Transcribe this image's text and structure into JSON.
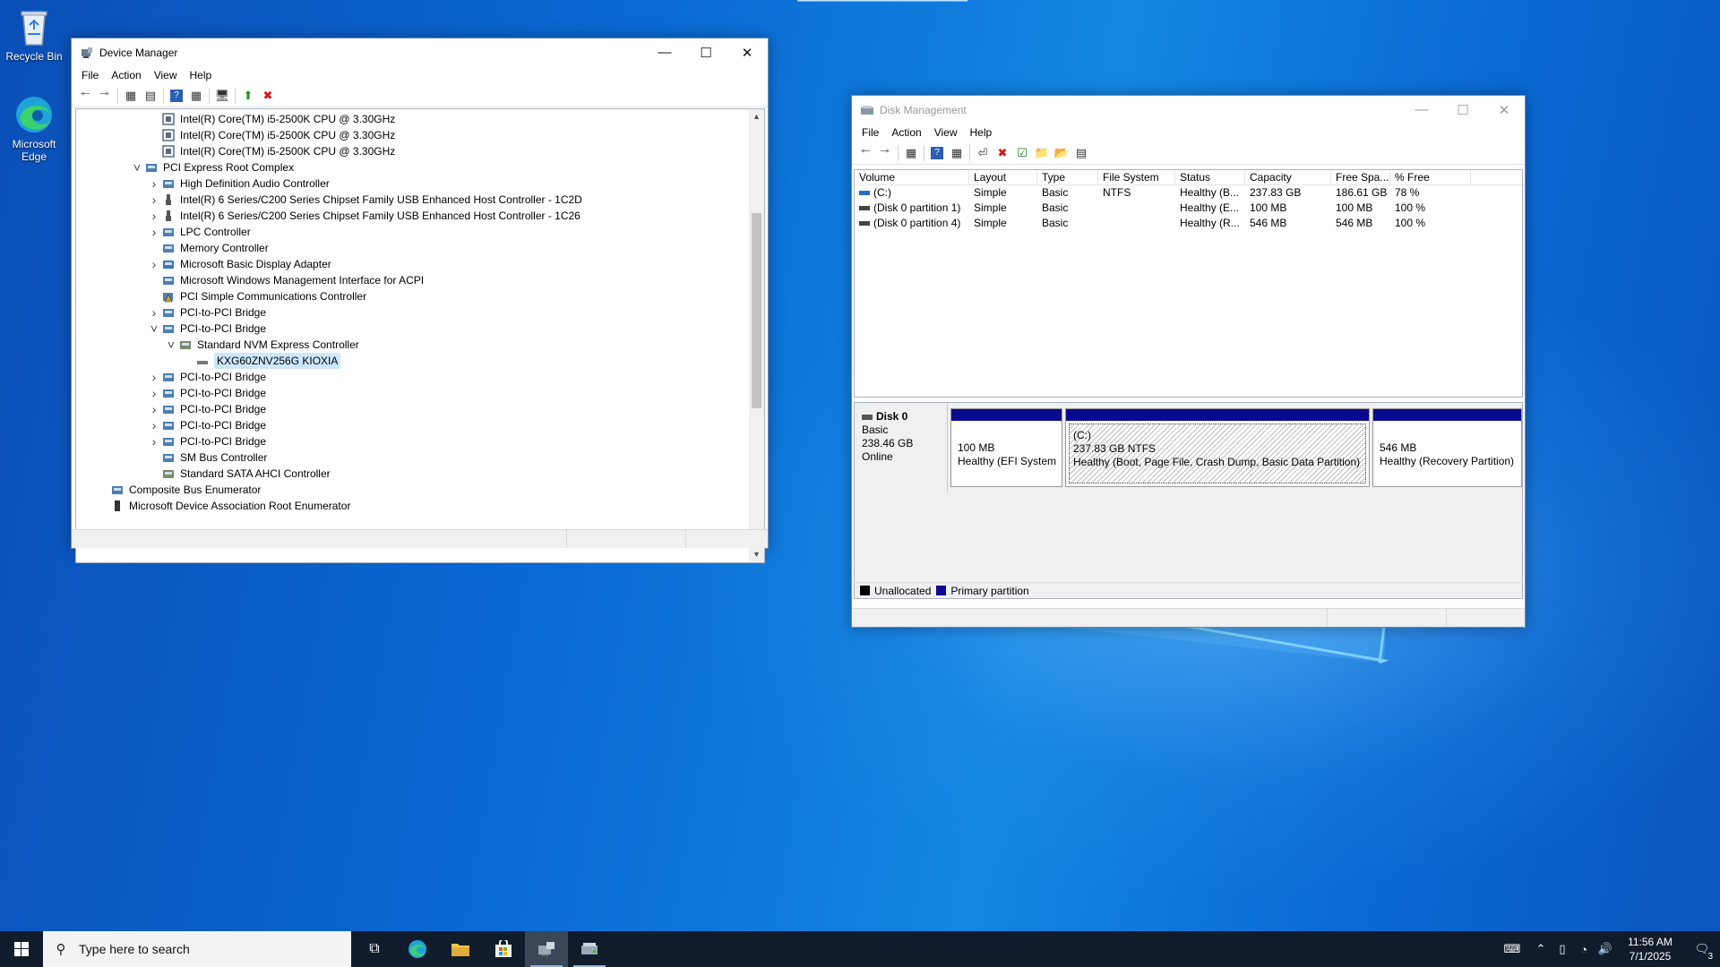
{
  "desktop": {
    "icons": [
      {
        "label": "Recycle Bin",
        "icon": "recycle-bin-icon"
      },
      {
        "label": "Microsoft Edge",
        "icon": "edge-icon"
      }
    ]
  },
  "device_manager": {
    "title": "Device Manager",
    "menu": [
      "File",
      "Action",
      "View",
      "Help"
    ],
    "tree": [
      {
        "label": "Intel(R) Core(TM) i5-2500K CPU @ 3.30GHz",
        "expander": "",
        "icon": "cpu-icon"
      },
      {
        "label": "Intel(R) Core(TM) i5-2500K CPU @ 3.30GHz",
        "expander": "",
        "icon": "cpu-icon"
      },
      {
        "label": "Intel(R) Core(TM) i5-2500K CPU @ 3.30GHz",
        "expander": "",
        "icon": "cpu-icon"
      },
      {
        "label": "PCI Express Root Complex",
        "expander": "expanded",
        "icon": "system-device-icon"
      },
      {
        "label": "High Definition Audio Controller",
        "expander": "collapsed",
        "icon": "system-device-icon"
      },
      {
        "label": "Intel(R) 6 Series/C200 Series Chipset Family USB Enhanced Host Controller - 1C2D",
        "expander": "collapsed",
        "icon": "usb-icon"
      },
      {
        "label": "Intel(R) 6 Series/C200 Series Chipset Family USB Enhanced Host Controller - 1C26",
        "expander": "collapsed",
        "icon": "usb-icon"
      },
      {
        "label": "LPC Controller",
        "expander": "collapsed",
        "icon": "system-device-icon"
      },
      {
        "label": "Memory Controller",
        "expander": "",
        "icon": "system-device-icon"
      },
      {
        "label": "Microsoft Basic Display Adapter",
        "expander": "collapsed",
        "icon": "display-adapter-icon"
      },
      {
        "label": "Microsoft Windows Management Interface for ACPI",
        "expander": "",
        "icon": "system-device-icon"
      },
      {
        "label": "PCI Simple Communications Controller",
        "expander": "",
        "icon": "warning-device-icon"
      },
      {
        "label": "PCI-to-PCI Bridge",
        "expander": "collapsed",
        "icon": "system-device-icon"
      },
      {
        "label": "PCI-to-PCI Bridge",
        "expander": "expanded",
        "icon": "system-device-icon"
      },
      {
        "label": "Standard NVM Express Controller",
        "expander": "expanded",
        "icon": "storage-controller-icon"
      },
      {
        "label": "KXG60ZNV256G KIOXIA",
        "expander": "",
        "icon": "disk-drive-icon",
        "selected": true
      },
      {
        "label": "PCI-to-PCI Bridge",
        "expander": "collapsed",
        "icon": "system-device-icon"
      },
      {
        "label": "PCI-to-PCI Bridge",
        "expander": "collapsed",
        "icon": "system-device-icon"
      },
      {
        "label": "PCI-to-PCI Bridge",
        "expander": "collapsed",
        "icon": "system-device-icon"
      },
      {
        "label": "PCI-to-PCI Bridge",
        "expander": "collapsed",
        "icon": "system-device-icon"
      },
      {
        "label": "PCI-to-PCI Bridge",
        "expander": "collapsed",
        "icon": "system-device-icon"
      },
      {
        "label": "SM Bus Controller",
        "expander": "",
        "icon": "system-device-icon"
      },
      {
        "label": "Standard SATA AHCI Controller",
        "expander": "",
        "icon": "storage-controller-icon"
      },
      {
        "label": "Composite Bus Enumerator",
        "expander": "",
        "icon": "system-device-icon"
      },
      {
        "label": "Microsoft Device Association Root Enumerator",
        "expander": "",
        "icon": "device-icon"
      }
    ]
  },
  "disk_management": {
    "title": "Disk Management",
    "menu": [
      "File",
      "Action",
      "View",
      "Help"
    ],
    "columns": [
      "Volume",
      "Layout",
      "Type",
      "File System",
      "Status",
      "Capacity",
      "Free Spa...",
      "% Free"
    ],
    "rows": [
      [
        "(C:)",
        "Simple",
        "Basic",
        "NTFS",
        "Healthy (B...",
        "237.83 GB",
        "186.61 GB",
        "78 %"
      ],
      [
        "(Disk 0 partition 1)",
        "Simple",
        "Basic",
        "",
        "Healthy (E...",
        "100 MB",
        "100 MB",
        "100 %"
      ],
      [
        "(Disk 0 partition 4)",
        "Simple",
        "Basic",
        "",
        "Healthy (R...",
        "546 MB",
        "546 MB",
        "100 %"
      ]
    ],
    "disk": {
      "name": "Disk 0",
      "type": "Basic",
      "size": "238.46 GB",
      "status": "Online",
      "partitions": [
        {
          "label": "",
          "size": "100 MB",
          "status": "Healthy (EFI System P"
        },
        {
          "label": "(C:)",
          "size": "237.83 GB NTFS",
          "status": "Healthy (Boot, Page File, Crash Dump, Basic Data Partition)"
        },
        {
          "label": "",
          "size": "546 MB",
          "status": "Healthy (Recovery Partition)"
        }
      ]
    },
    "legend": [
      {
        "label": "Unallocated",
        "color": "#000000"
      },
      {
        "label": "Primary partition",
        "color": "#0a0a8c"
      }
    ]
  },
  "taskbar": {
    "search_placeholder": "Type here to search",
    "time": "11:56 AM",
    "date": "7/1/2025",
    "notification_count": "3"
  }
}
